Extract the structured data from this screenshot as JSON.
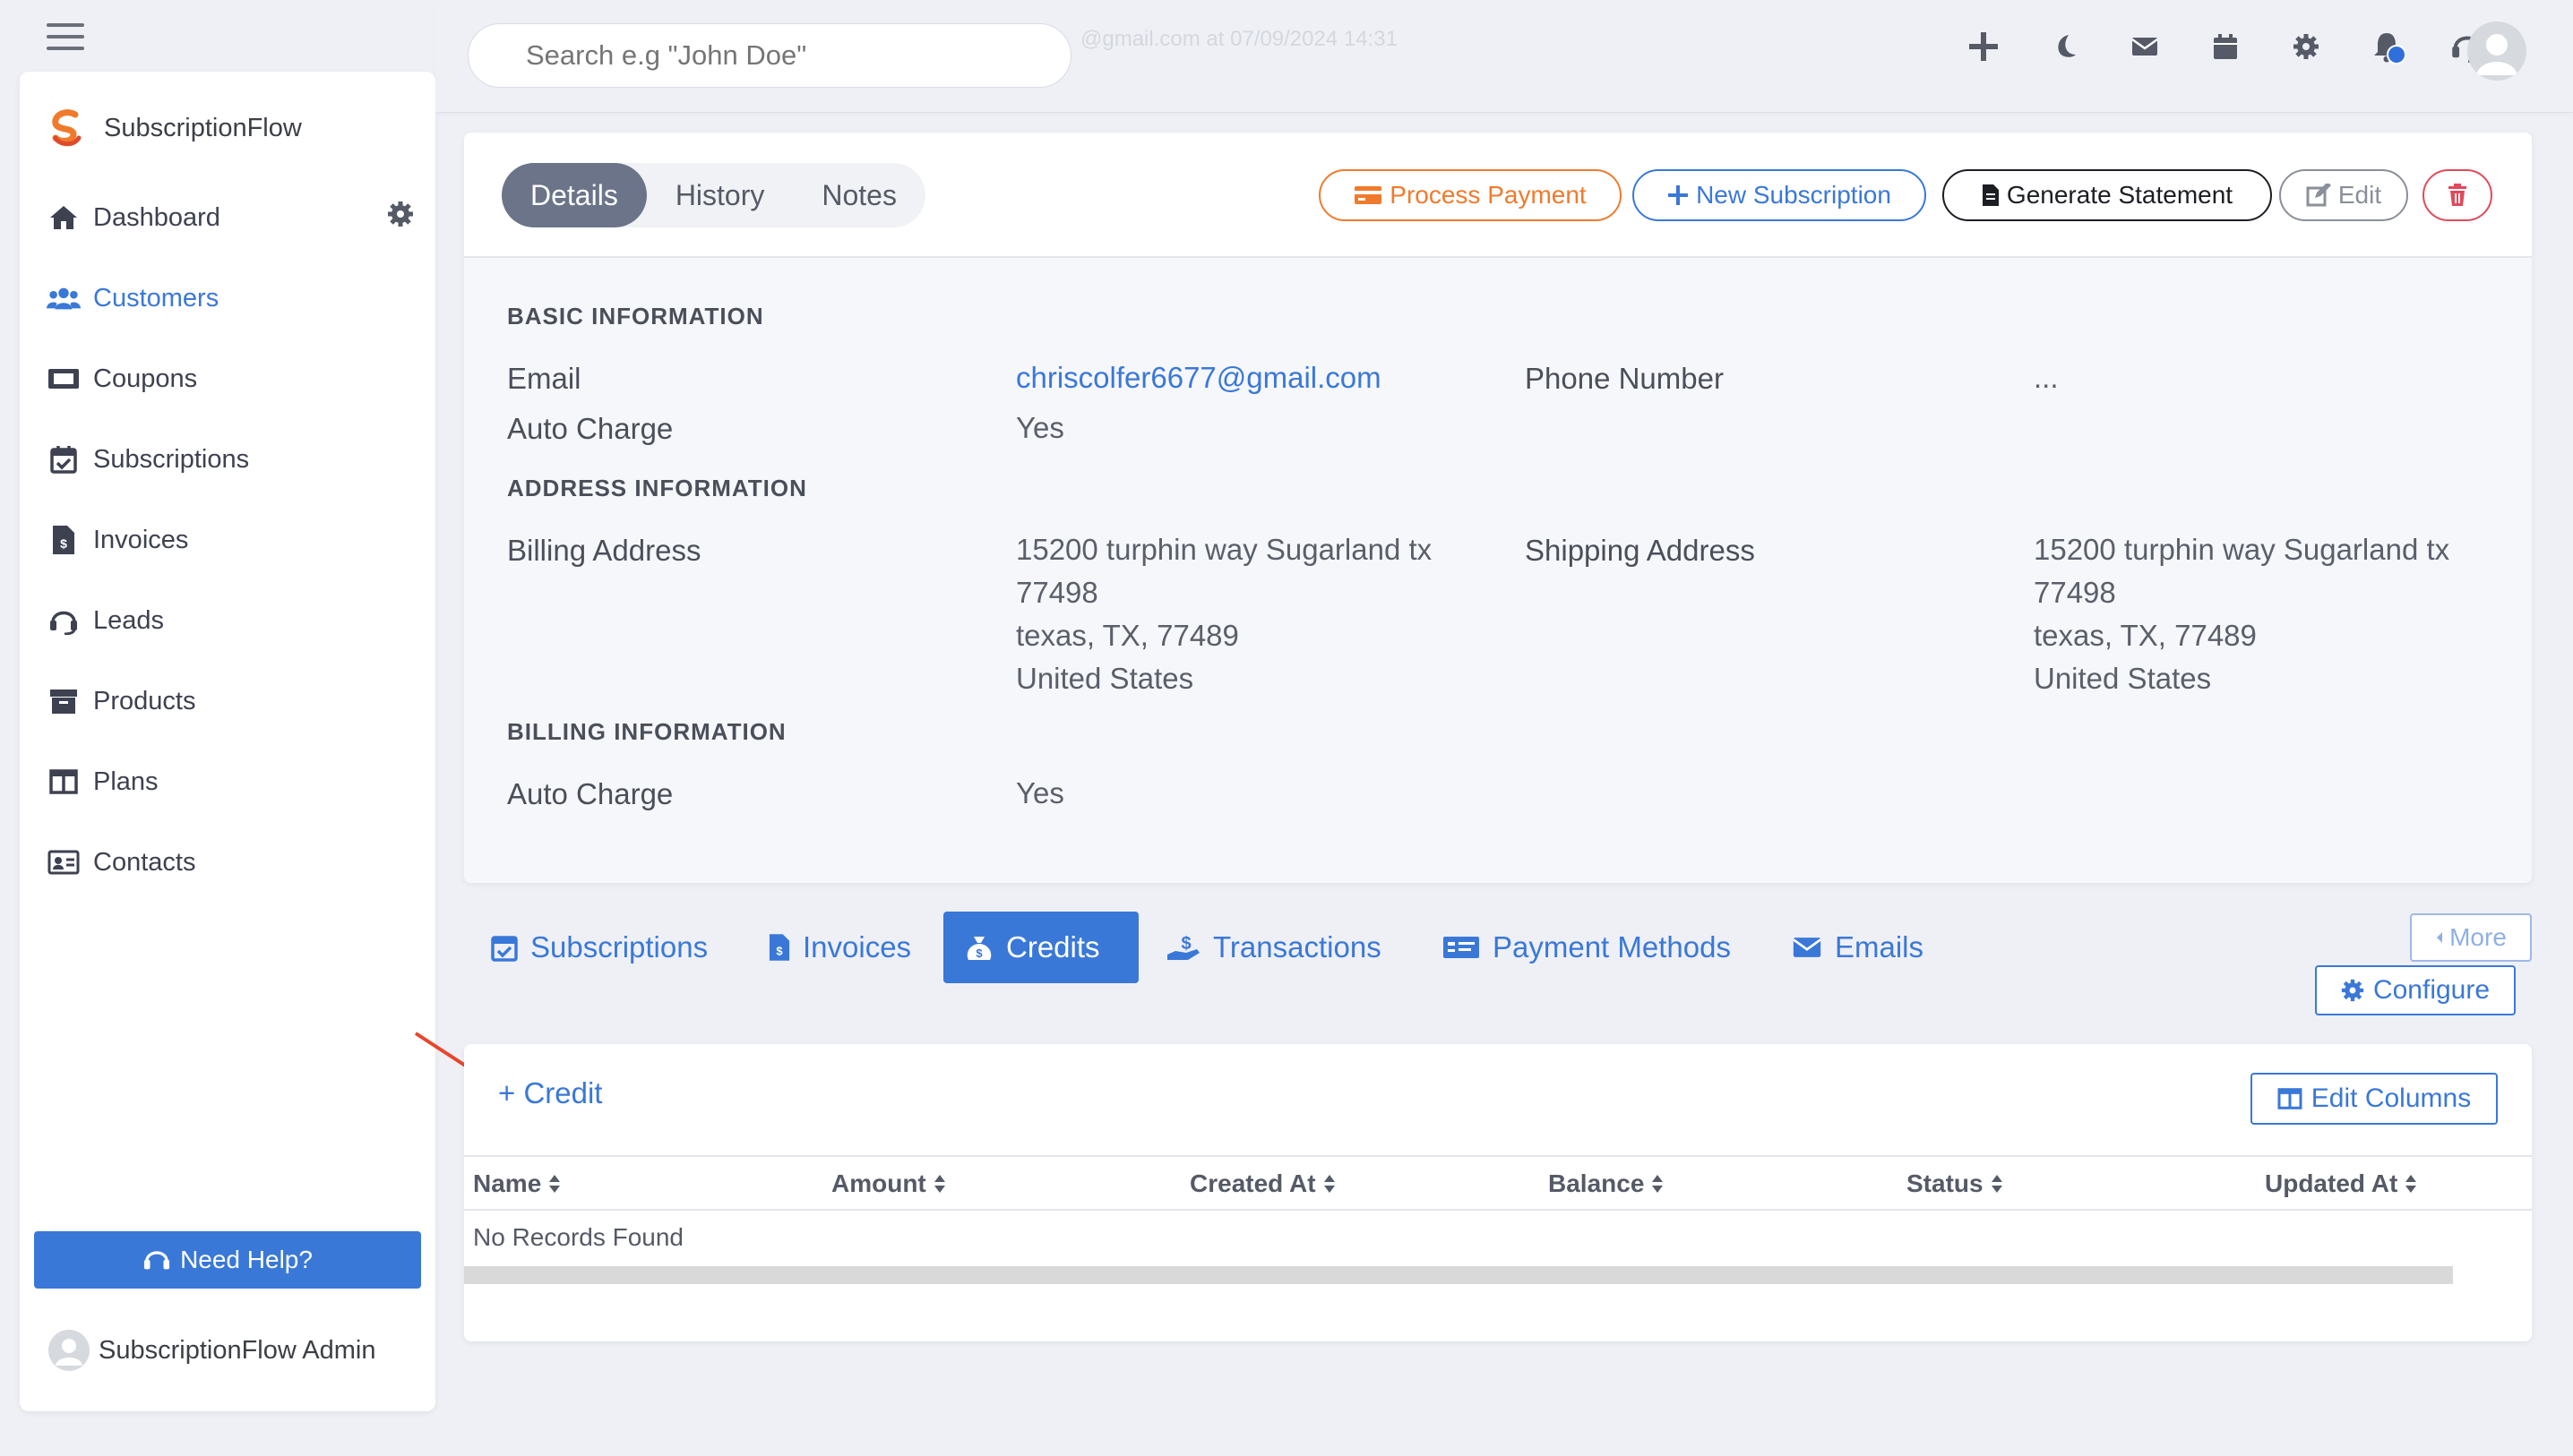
{
  "app": {
    "brand_name": "SubscriptionFlow",
    "accent_color": "#3a78d8",
    "orange": "#f07a2c",
    "danger": "#e04a5a"
  },
  "topbar": {
    "search_placeholder": "Search e.g \"John Doe\"",
    "faded_text": "@gmail.com at 07/09/2024 14:31",
    "icons": [
      "plus-icon",
      "moon-icon",
      "envelope-icon",
      "calendar-icon",
      "gear-icon",
      "bell-icon",
      "headset-icon",
      "user-avatar"
    ]
  },
  "sidebar": {
    "items": [
      {
        "label": "Dashboard",
        "icon": "home-icon"
      },
      {
        "label": "Customers",
        "icon": "users-icon",
        "active": true
      },
      {
        "label": "Coupons",
        "icon": "ticket-icon"
      },
      {
        "label": "Subscriptions",
        "icon": "calendar-check-icon"
      },
      {
        "label": "Invoices",
        "icon": "file-invoice-icon"
      },
      {
        "label": "Leads",
        "icon": "headset-icon"
      },
      {
        "label": "Products",
        "icon": "archive-icon"
      },
      {
        "label": "Plans",
        "icon": "columns-icon"
      },
      {
        "label": "Contacts",
        "icon": "address-card-icon"
      }
    ],
    "help_label": "Need Help?",
    "admin_name": "SubscriptionFlow Admin"
  },
  "detail": {
    "tabs": [
      "Details",
      "History",
      "Notes"
    ],
    "active_tab": "Details",
    "actions": {
      "process_payment": "Process Payment",
      "new_subscription": "New Subscription",
      "generate_statement": "Generate Statement",
      "edit": "Edit"
    },
    "sections": {
      "basic": "BASIC INFORMATION",
      "address": "ADDRESS INFORMATION",
      "billing": "BILLING INFORMATION"
    },
    "fields": {
      "email_label": "Email",
      "email_value": "chriscolfer6677@gmail.com",
      "phone_label": "Phone Number",
      "phone_value": "...",
      "auto_charge_label": "Auto Charge",
      "auto_charge_value": "Yes",
      "billing_address_label": "Billing Address",
      "billing_address_lines": [
        "15200 turphin way Sugarland tx",
        "77498",
        "texas, TX, 77489",
        "United States"
      ],
      "shipping_address_label": "Shipping Address",
      "shipping_address_lines": [
        "15200 turphin way Sugarland tx",
        "77498",
        "texas, TX, 77489",
        "United States"
      ],
      "billing_auto_charge_label": "Auto Charge",
      "billing_auto_charge_value": "Yes"
    }
  },
  "related_tabs": {
    "items": [
      "Subscriptions",
      "Invoices",
      "Credits",
      "Transactions",
      "Payment Methods",
      "Emails"
    ],
    "active": "Credits",
    "more_label": "More",
    "configure_label": "Configure"
  },
  "credits": {
    "add_label": "+ Credit",
    "edit_columns_label": "Edit Columns",
    "columns": [
      "Name",
      "Amount",
      "Created At",
      "Balance",
      "Status",
      "Updated At"
    ],
    "empty_text": "No Records Found"
  }
}
